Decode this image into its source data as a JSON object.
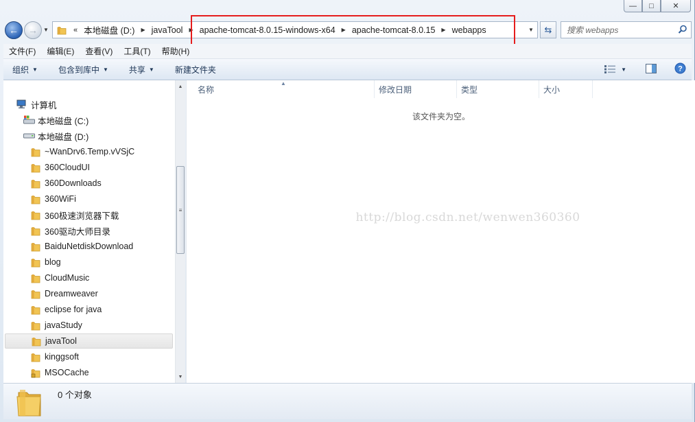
{
  "window": {
    "controls": {
      "minimize": "—",
      "maximize": "□",
      "close": "✕"
    }
  },
  "nav": {
    "back_glyph": "←",
    "forward_glyph": "→",
    "history_glyph": "▼",
    "breadcrumb_overflow": "«",
    "breadcrumbs": [
      "本地磁盘 (D:)",
      "javaTool",
      "apache-tomcat-8.0.15-windows-x64",
      "apache-tomcat-8.0.15",
      "webapps"
    ],
    "crumb_separator": "▶",
    "dropdown_glyph": "▼",
    "refresh_glyph": "⇆",
    "search_placeholder": "搜索 webapps"
  },
  "menubar": {
    "items": [
      "文件(F)",
      "编辑(E)",
      "查看(V)",
      "工具(T)",
      "帮助(H)"
    ]
  },
  "commandbar": {
    "organize": "组织",
    "include_in_library": "包含到库中",
    "share": "共享",
    "new_folder": "新建文件夹",
    "arrow": "▼"
  },
  "navpane": {
    "computer": "计算机",
    "drive_c": "本地磁盘 (C:)",
    "drive_d": "本地磁盘 (D:)",
    "folders": [
      "~WanDrv6.Temp.vVSjC",
      "360CloudUI",
      "360Downloads",
      "360WiFi",
      "360极速浏览器下载",
      "360驱动大师目录",
      "BaiduNetdiskDownload",
      "blog",
      "CloudMusic",
      "Dreamweaver",
      "eclipse for java",
      "javaStudy",
      "javaTool",
      "kinggsoft",
      "MSOCache"
    ],
    "selected_folder": "javaTool",
    "scroll": {
      "up": "▲",
      "down": "▼",
      "grip": "≡"
    }
  },
  "mainpane": {
    "columns": [
      "名称",
      "修改日期",
      "类型",
      "大小"
    ],
    "sort_glyph": "▲",
    "empty_message": "该文件夹为空。",
    "watermark": "http://blog.csdn.net/wenwen360360"
  },
  "details": {
    "object_count": "0 个对象"
  },
  "colors": {
    "highlight_box": "#e51c1c",
    "folder_yellow": "#f1c453",
    "accent_blue": "#2c64b7"
  }
}
